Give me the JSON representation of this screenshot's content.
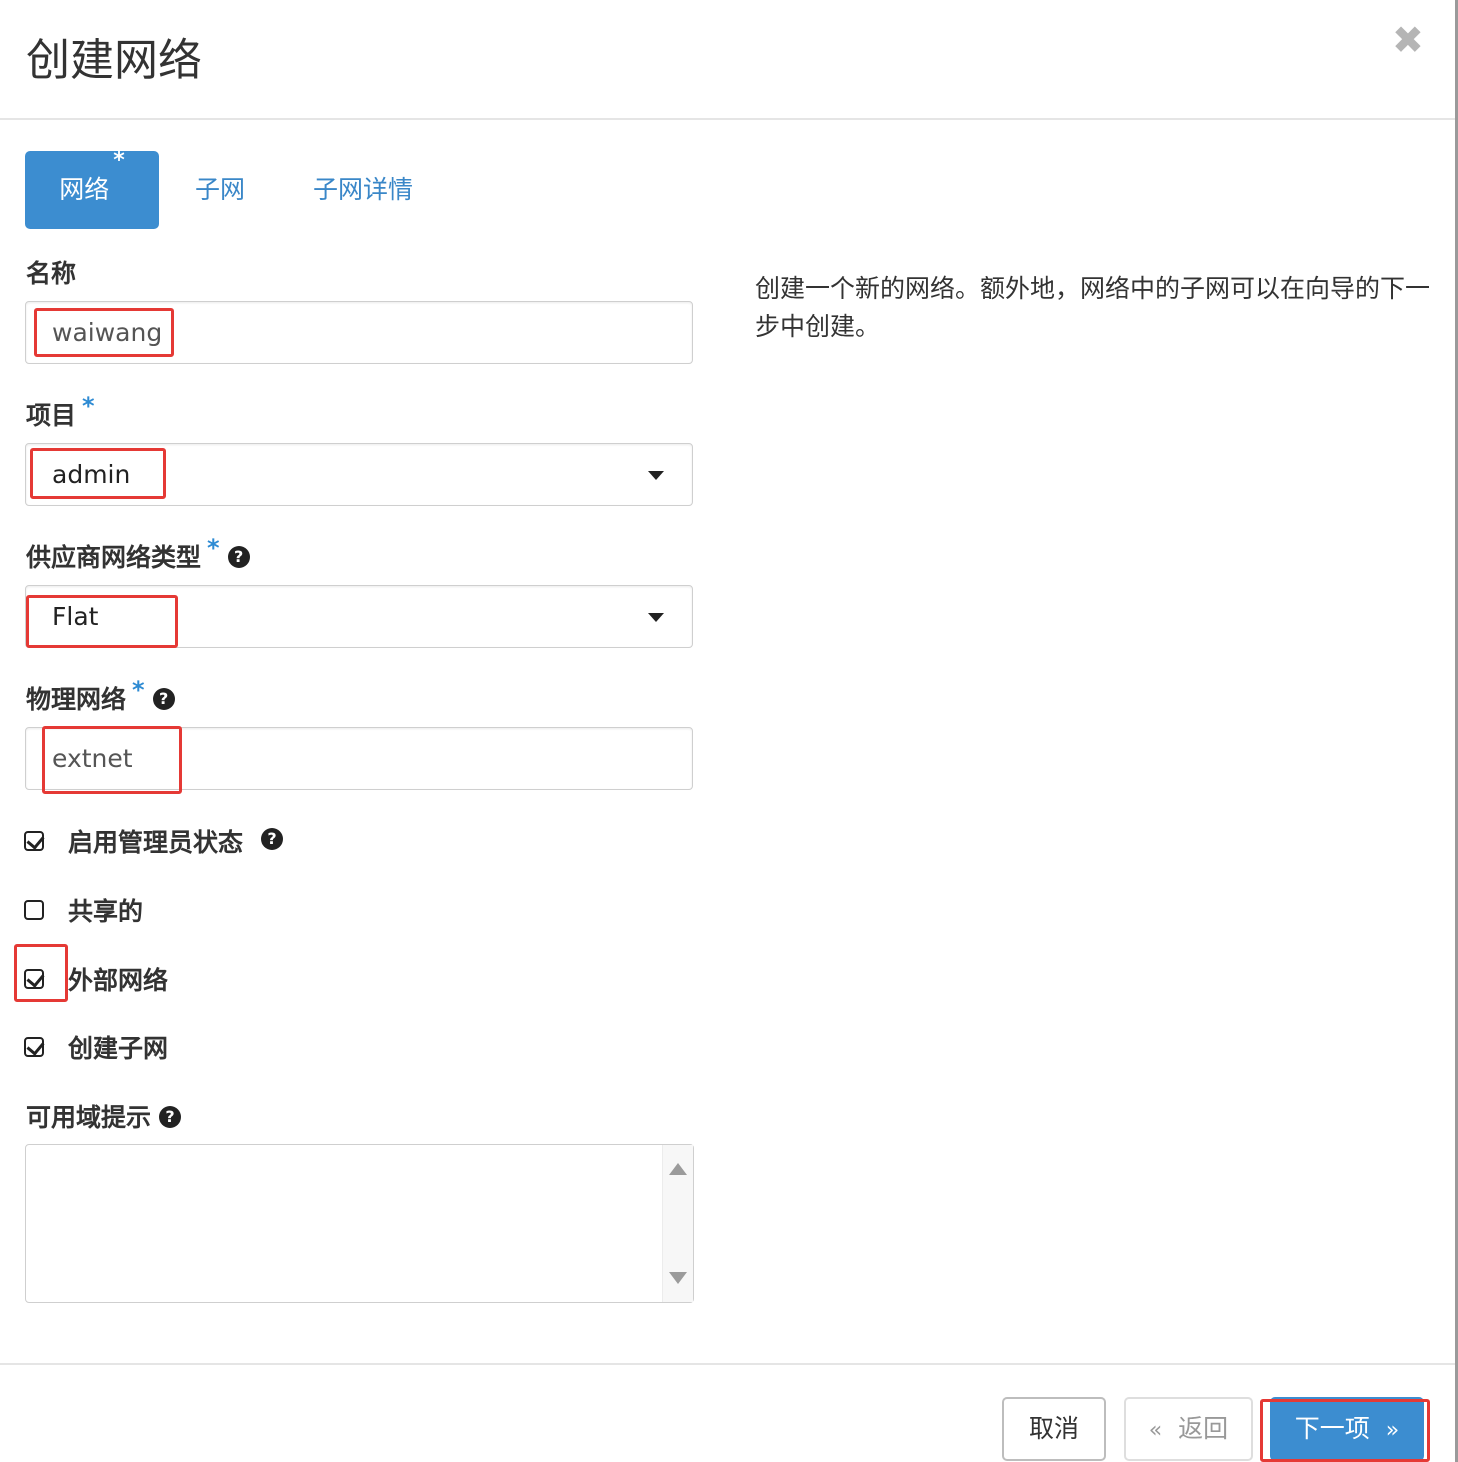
{
  "dialog": {
    "title": "创建网络",
    "close_glyph": "✖"
  },
  "tabs": [
    {
      "label": "网络",
      "required_mark": "*"
    },
    {
      "label": "子网"
    },
    {
      "label": "子网详情"
    }
  ],
  "form": {
    "name": {
      "label": "名称",
      "value": "waiwang"
    },
    "project": {
      "label": "项目",
      "required_mark": "*",
      "value": "admin"
    },
    "provider_network_type": {
      "label": "供应商网络类型",
      "required_mark": "*",
      "value": "Flat"
    },
    "physical_network": {
      "label": "物理网络",
      "required_mark": "*",
      "value": "extnet"
    },
    "admin_state": {
      "label": "启用管理员状态",
      "checked": true
    },
    "shared": {
      "label": "共享的",
      "checked": false
    },
    "external_network": {
      "label": "外部网络",
      "checked": true
    },
    "create_subnet": {
      "label": "创建子网",
      "checked": true
    },
    "availability_zone_hints": {
      "label": "可用域提示"
    }
  },
  "help_glyph": "?",
  "help_text": "创建一个新的网络。额外地，网络中的子网可以在向导的下一步中创建。",
  "footer": {
    "cancel_label": "取消",
    "back_chevron": "«",
    "back_label": "返回",
    "next_label": "下一项",
    "next_chevron": "»"
  },
  "colors": {
    "primary": "#3c8dd0",
    "required": "#2e8bd3",
    "highlight": "#e53935"
  }
}
